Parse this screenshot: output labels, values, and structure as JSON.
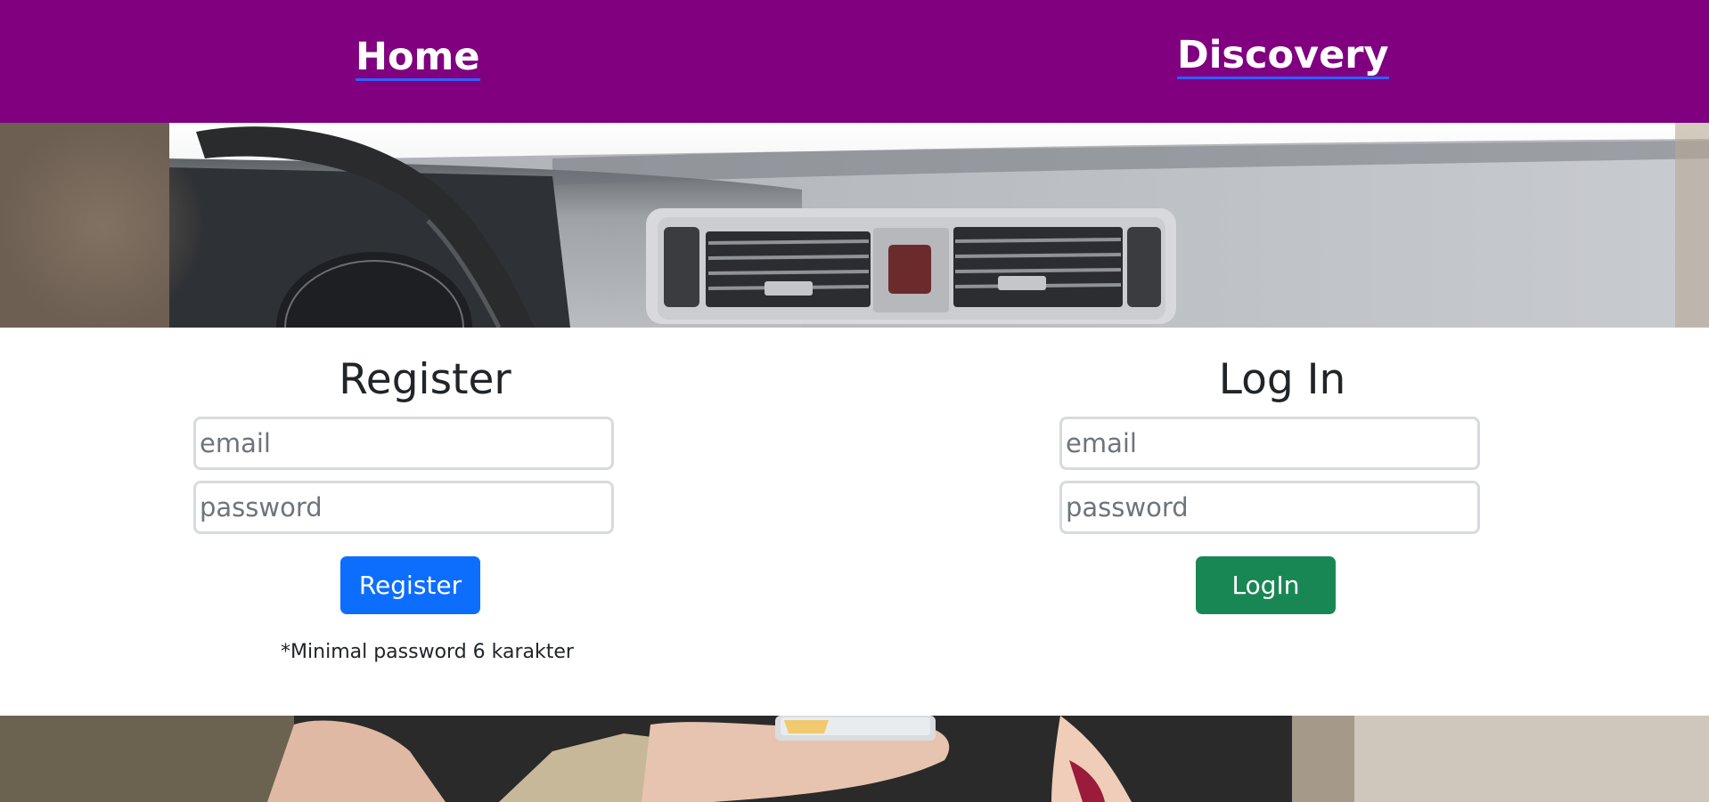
{
  "nav": {
    "home_label": "Home",
    "discovery_label": "Discovery",
    "background_color": "#800080"
  },
  "register": {
    "title": "Register",
    "email_placeholder": "email",
    "password_placeholder": "password",
    "button_label": "Register",
    "button_color": "#0d6efd",
    "hint": "*Minimal password 6 karakter"
  },
  "login": {
    "title": "Log In",
    "email_placeholder": "email",
    "password_placeholder": "password",
    "button_label": "LogIn",
    "button_color": "#198754"
  }
}
